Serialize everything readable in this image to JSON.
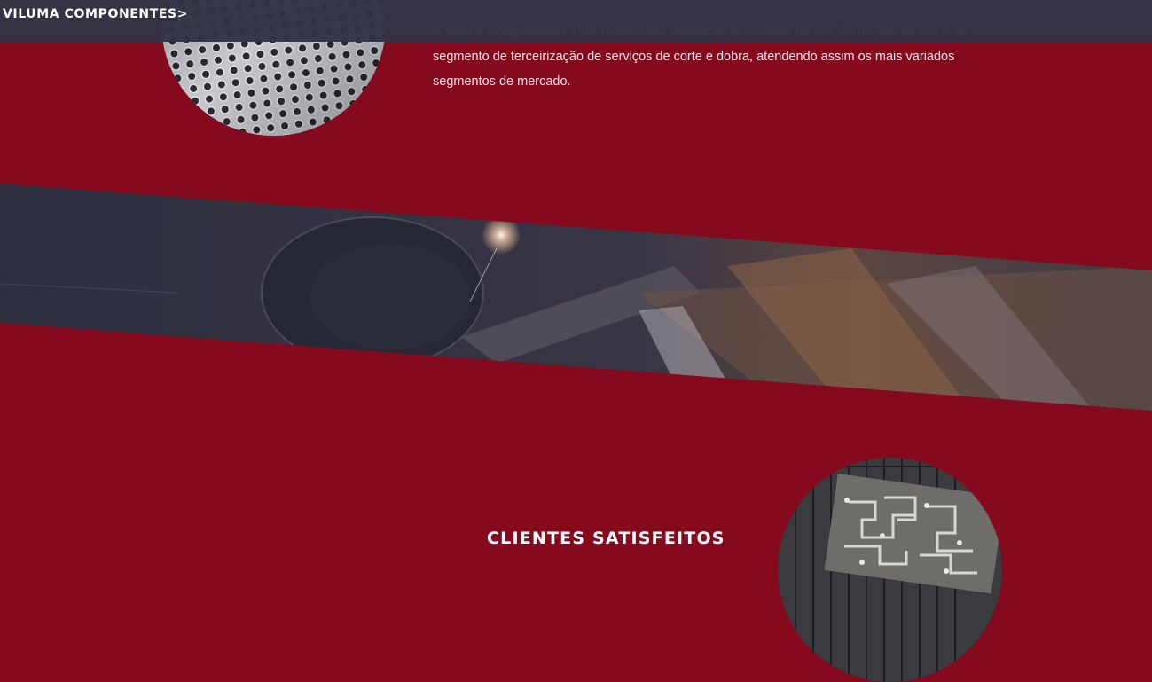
{
  "header": {
    "brand": "VILUMA COMPONENTES>"
  },
  "about": {
    "text": "A Viluma Componentes Ltda iniciou suas atividades em Caxias do Sul-RS no ano de 2012, no segmento de terceirização de serviços de corte e dobra, atendendo assim os mais variados segmentos de mercado."
  },
  "clients": {
    "title": "CLIENTES SATISFEITOS"
  },
  "colors": {
    "background": "#850a1d",
    "header": "#323444",
    "band_dark": "#2d2f3d",
    "text_light": "#f2e3e6"
  },
  "images": {
    "top_circle": "perforated-metal-sheet-photo",
    "banner": "laser-cutting-metal-photo",
    "bottom_circle": "cut-metal-parts-photo"
  }
}
